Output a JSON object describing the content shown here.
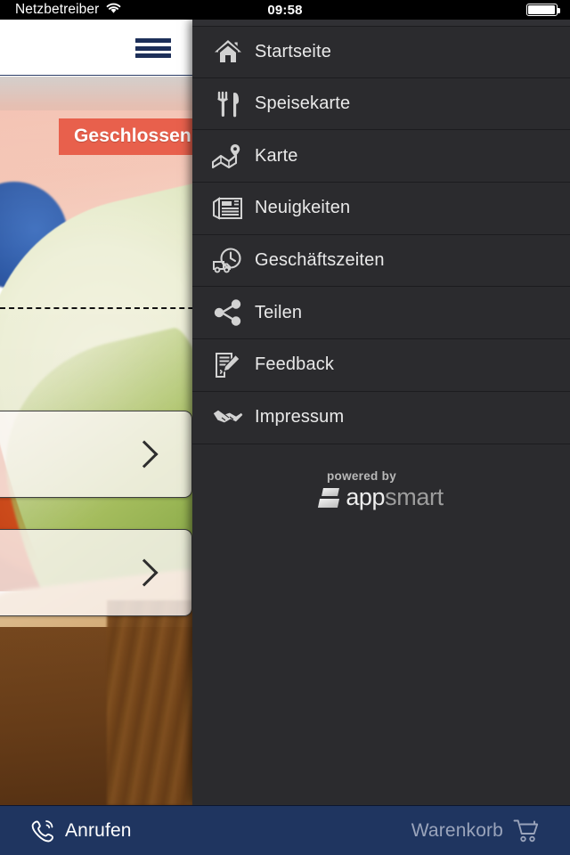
{
  "statusbar": {
    "carrier": "Netzbetreiber",
    "wifi_icon": "wifi-icon",
    "time": "09:58",
    "battery_icon": "battery-full-icon"
  },
  "app_header": {
    "menu_icon": "hamburger-menu-icon"
  },
  "hero": {
    "badge": "Geschlossen",
    "badge_color": "#e8604c",
    "button1_icon": "chevron-right-icon",
    "button2_icon": "chevron-right-icon"
  },
  "drawer": {
    "background_color": "#2b2b2e",
    "items": [
      {
        "label": "Startseite",
        "icon": "home-icon"
      },
      {
        "label": "Speisekarte",
        "icon": "fork-knife-icon"
      },
      {
        "label": "Karte",
        "icon": "map-pin-icon"
      },
      {
        "label": "Neuigkeiten",
        "icon": "newspaper-icon"
      },
      {
        "label": "Geschäftszeiten",
        "icon": "delivery-clock-icon"
      },
      {
        "label": "Teilen",
        "icon": "share-icon"
      },
      {
        "label": "Feedback",
        "icon": "document-pencil-icon"
      },
      {
        "label": "Impressum",
        "icon": "handshake-icon"
      }
    ],
    "powered_by": {
      "prefix": "powered by",
      "brand_first": "app",
      "brand_second": "smart",
      "mark_icon": "appsmart-logo-icon"
    }
  },
  "tabbar": {
    "background_color": "#1f3560",
    "call_label": "Anrufen",
    "call_icon": "phone-icon",
    "cart_label": "Warenkorb",
    "cart_icon": "shopping-cart-icon"
  }
}
